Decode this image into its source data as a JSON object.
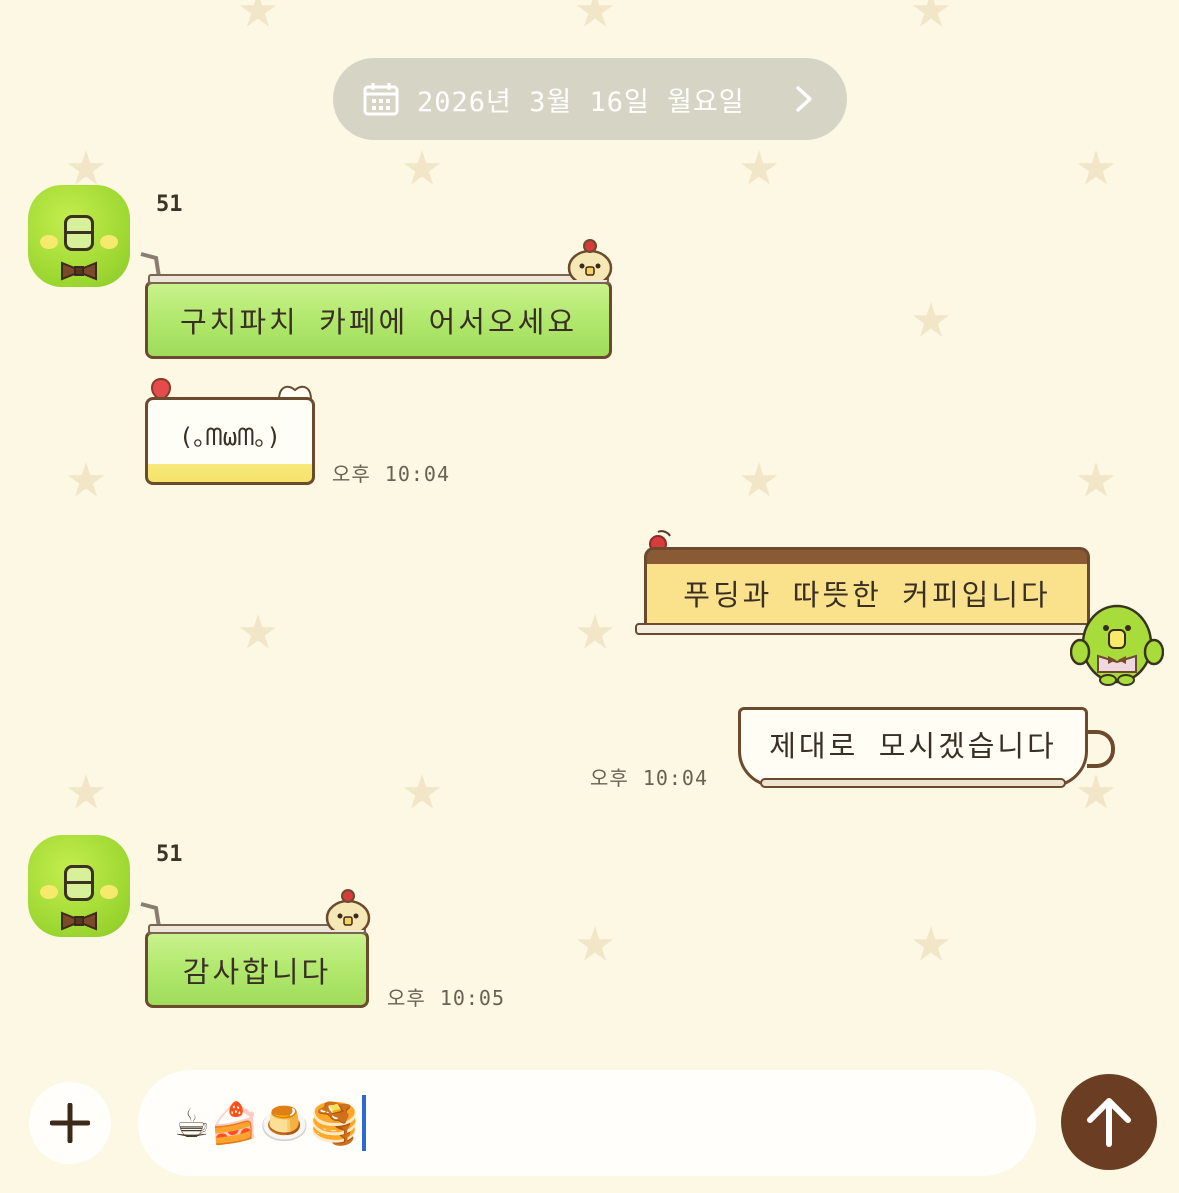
{
  "date_divider": {
    "text": "2026년 3월 16일 월요일",
    "icon": "calendar-icon",
    "chevron": "chevron-right-icon"
  },
  "messages": [
    {
      "sender": "51",
      "side": "left",
      "text": "구치파치 카페에 어서오세요",
      "style": "green-drink"
    },
    {
      "sender": "51",
      "side": "left",
      "text": "(｡ᗰωᗰ｡)",
      "style": "cake",
      "ampm": "오후",
      "time": "10:04"
    },
    {
      "side": "right",
      "text": "푸딩과 따뜻한 커피입니다",
      "style": "pudding"
    },
    {
      "side": "right",
      "text": "제대로 모시겠습니다",
      "style": "coffee-cup",
      "ampm": "오후",
      "time": "10:04"
    },
    {
      "sender": "51",
      "side": "left",
      "text": "감사합니다",
      "style": "green-drink",
      "ampm": "오후",
      "time": "10:05"
    }
  ],
  "composer": {
    "add_icon": "plus-icon",
    "input_value": "☕🍰🍮🥞",
    "send_icon": "arrow-up-icon"
  },
  "colors": {
    "background": "#fdf8e4",
    "send_button": "#6b3e23",
    "date_pill": "#d6d5c5",
    "caret": "#2c68d8"
  }
}
